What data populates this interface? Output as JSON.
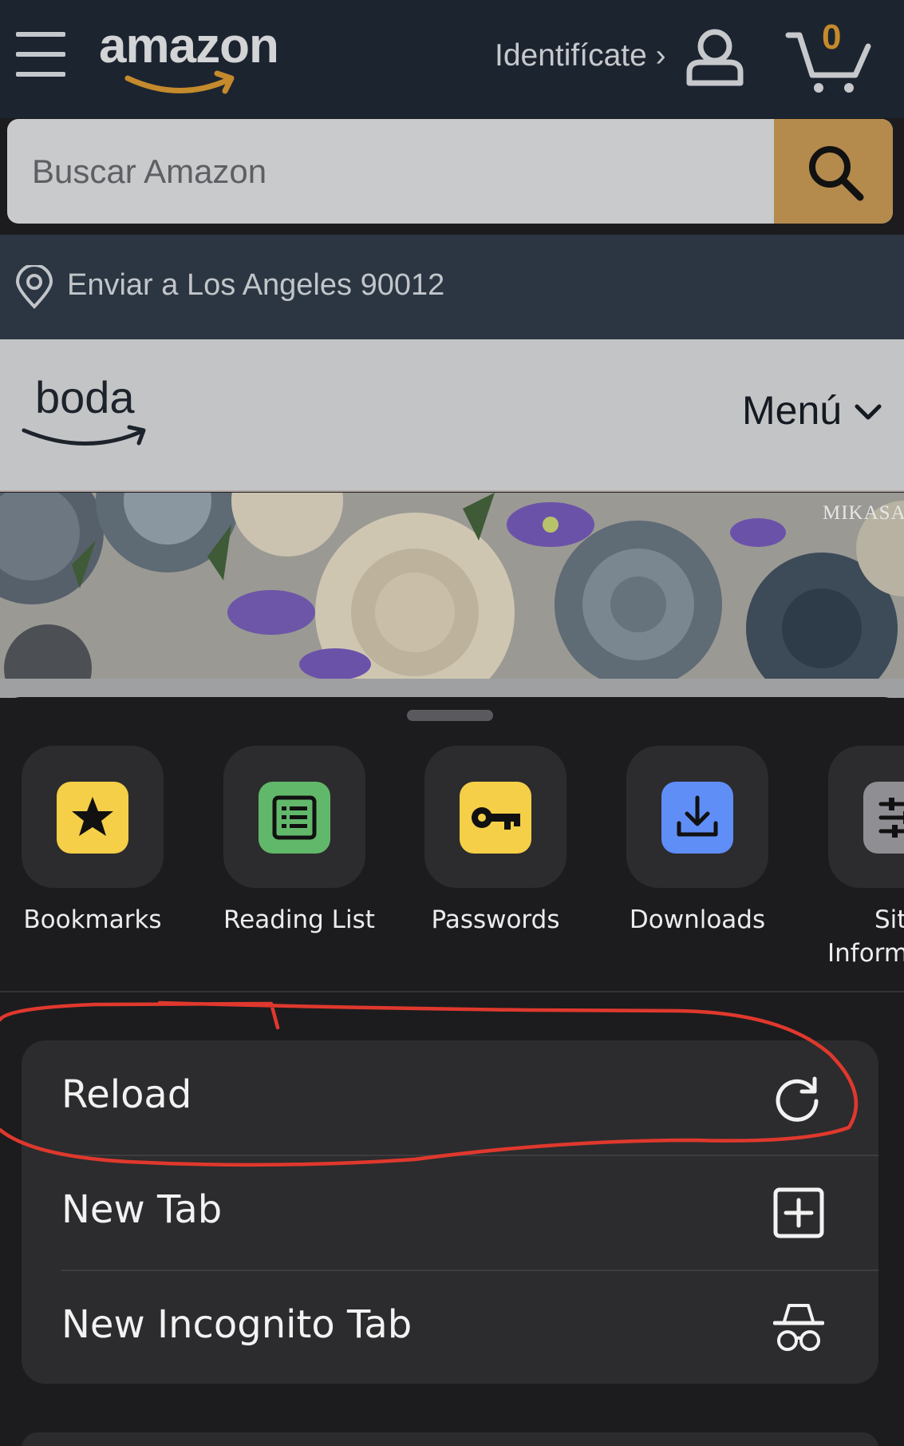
{
  "amazon": {
    "logo": "amazon",
    "signin_label": "Identifícate ›",
    "cart_count": "0",
    "search_placeholder": "Buscar Amazon",
    "deliver_to": "Enviar a Los Angeles 90012"
  },
  "boda": {
    "logo": "boda",
    "menu_label": "Menú"
  },
  "banner": {
    "brand": "MIKASA."
  },
  "sheet": {
    "quick_actions": [
      {
        "label": "Bookmarks",
        "icon": "star-icon",
        "color": "#f4cf47"
      },
      {
        "label": "Reading List",
        "icon": "reading-list-icon",
        "color": "#62b86a"
      },
      {
        "label": "Passwords",
        "icon": "key-icon",
        "color": "#f4cf47"
      },
      {
        "label": "Downloads",
        "icon": "download-icon",
        "color": "#5f8ef7"
      },
      {
        "label": "Site Information",
        "label_line1": "Sit",
        "label_line2": "Inform",
        "icon": "site-info-icon",
        "color": "#8e8e93"
      }
    ],
    "actions": [
      {
        "label": "Reload",
        "icon": "reload-icon"
      },
      {
        "label": "New Tab",
        "icon": "new-tab-icon"
      },
      {
        "label": "New Incognito Tab",
        "icon": "incognito-icon"
      }
    ]
  },
  "colors": {
    "sheet_bg": "#1c1c1e",
    "tile_bg": "#2c2c2e",
    "annotation": "#e0382d",
    "amazon_dark": "#1c2430",
    "search_button": "#b48a4d"
  }
}
